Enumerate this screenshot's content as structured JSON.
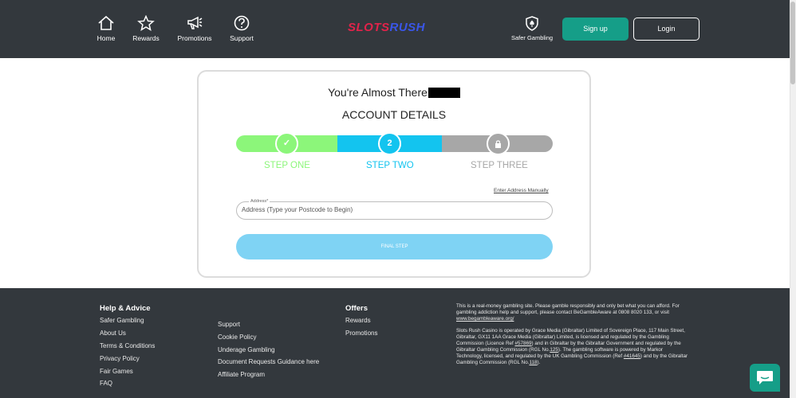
{
  "header": {
    "nav": [
      {
        "label": "Home",
        "icon": "home-icon"
      },
      {
        "label": "Rewards",
        "icon": "star-icon"
      },
      {
        "label": "Promotions",
        "icon": "megaphone-icon"
      },
      {
        "label": "Support",
        "icon": "question-icon"
      }
    ],
    "logo": {
      "part1": "SLOTS",
      "part2": "RUSH"
    },
    "safer_gambling": "Safer Gambling",
    "signup": "Sign up",
    "login": "Login"
  },
  "card": {
    "heading": "You're Almost There",
    "subheading": "ACCOUNT DETAILS",
    "steps": [
      {
        "label": "STEP ONE",
        "marker": "✓",
        "status": "complete"
      },
      {
        "label": "STEP TWO",
        "marker": "2",
        "status": "current"
      },
      {
        "label": "STEP THREE",
        "marker": "lock",
        "status": "locked"
      }
    ],
    "manual_link": "Enter Address Manually",
    "address_label": "Address*",
    "address_placeholder": "Address (Type your Postcode to Begin)",
    "final_button": "FINAL STEP"
  },
  "footer": {
    "help_heading": "Help & Advice",
    "help_links": [
      "Safer Gambling",
      "About Us",
      "Terms & Conditions",
      "Privacy Policy",
      "Fair Games",
      "FAQ"
    ],
    "support_links": [
      "Support",
      "Cookie Policy",
      "Underage Gambling",
      "Document Requests Guidance here",
      "Affiliate Program"
    ],
    "offers_heading": "Offers",
    "offers_links": [
      "Rewards",
      "Promotions"
    ],
    "legal_1a": "This is a real-money gambling site. Please gamble responsibly and only bet what you can afford. For gambling addiction help and support, please contact BeGambleAware at 0808 8020 133, or visit ",
    "legal_1_link": "www.begambleaware.org/",
    "legal_2a": "Slots Rush Casino is operated by Grace Media (Gibraltar) Limited of Sovereign Place, 117 Main Street, Gibraltar, GX11 1AA Grace Media (Gibraltar) Limited, is licensed and regulated by the Gambling Commission (Licence Ref ",
    "legal_2_l1": "#57869",
    "legal_2b": ") and in Gibraltar by the Gibraltar Government and regulated by the Gibraltar Gambling Commission (RGL No.",
    "legal_2_l2": "125",
    "legal_2c": "). The gambling software is powered by Markor Technology, licensed, and regulated by the UK Gambling Commission (Ref ",
    "legal_2_l3": "#41645",
    "legal_2d": ") and by the Gibraltar Gambling Commission (RGL No.",
    "legal_2_l4": "118",
    "legal_2e": ")."
  },
  "colors": {
    "header_bg": "#33383d",
    "accent": "#159e88",
    "step_complete": "#8cf67a",
    "step_current": "#13c4ef",
    "step_locked": "#a7a7a7",
    "final_button": "#7fd3f4"
  }
}
